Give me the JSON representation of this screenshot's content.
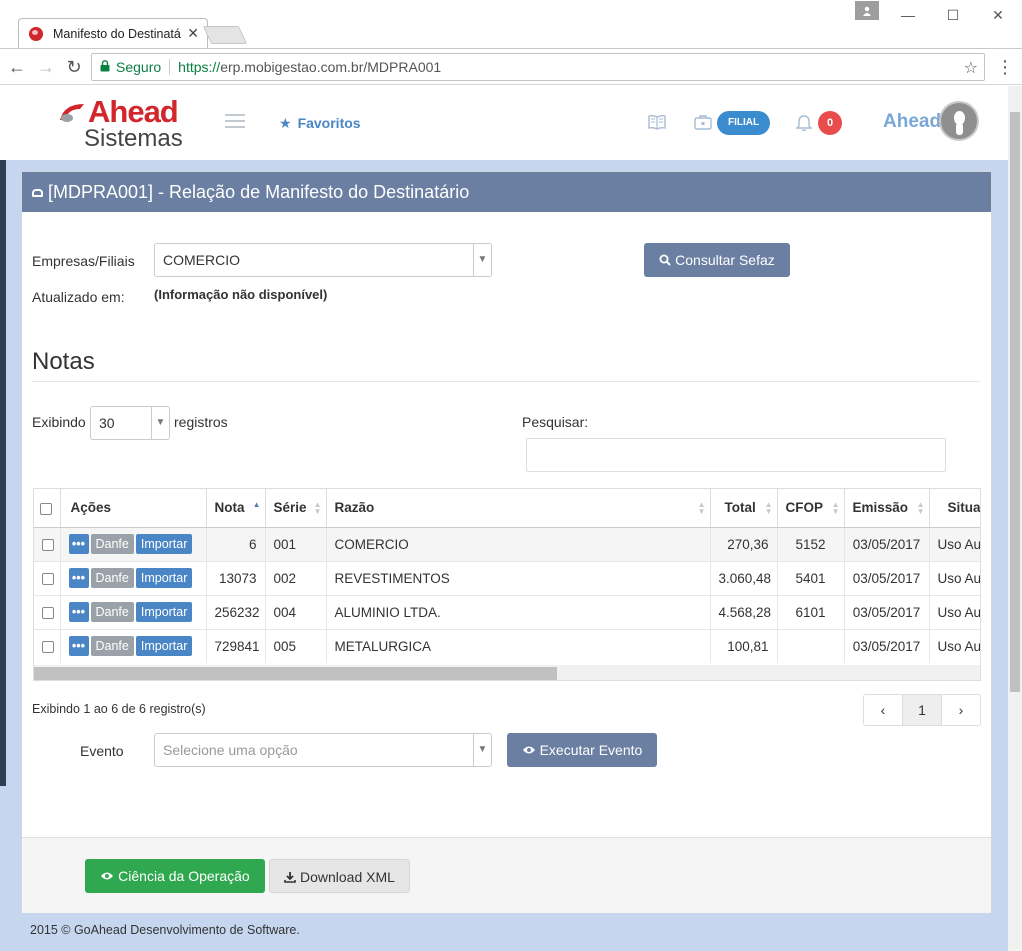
{
  "browser": {
    "tab_title": "Manifesto do Destinatário",
    "tab_close": "✕",
    "window_minimize": "—",
    "window_maximize": "☐",
    "window_close": "✕",
    "secure_label": "Seguro",
    "url_scheme": "https://",
    "url_rest": "erp.mobigestao.com.br/MDPRA001"
  },
  "header": {
    "logo_ahead": "Ahead",
    "logo_sistemas": "Sistemas",
    "favoritos": "Favoritos",
    "filial": "FILIAL",
    "notifications": "0",
    "user_name": "Ahead"
  },
  "card": {
    "title": "[MDPRA001] - Relação de Manifesto do Destinatário",
    "empresas_label": "Empresas/Filiais",
    "empresas_value": "COMERCIO",
    "consultar_button": "Consultar Sefaz",
    "atualizado_label": "Atualizado em:",
    "atualizado_value": "(Informação não disponível)"
  },
  "notas": {
    "title": "Notas",
    "exibindo_label": "Exibindo",
    "page_size": "30",
    "registros_label": "registros",
    "pesquisar_label": "Pesquisar:",
    "columns": [
      "Ações",
      "Nota",
      "Série",
      "Razão",
      "Total",
      "CFOP",
      "Emissão",
      "Situa"
    ],
    "action_labels": {
      "more": "•••",
      "danfe": "Danfe",
      "importar": "Importar"
    },
    "rows": [
      {
        "nota": "6",
        "serie": "001",
        "razao": "COMERCIO",
        "total": "270,36",
        "cfop": "5152",
        "emissao": "03/05/2017",
        "situacao": "Uso Au"
      },
      {
        "nota": "13073",
        "serie": "002",
        "razao": "REVESTIMENTOS",
        "total": "3.060,48",
        "cfop": "5401",
        "emissao": "03/05/2017",
        "situacao": "Uso Au"
      },
      {
        "nota": "256232",
        "serie": "004",
        "razao": "ALUMINIO LTDA.",
        "total": "4.568,28",
        "cfop": "6101",
        "emissao": "03/05/2017",
        "situacao": "Uso Au"
      },
      {
        "nota": "729841",
        "serie": "005",
        "razao": "METALURGICA",
        "total": "100,81",
        "cfop": "",
        "emissao": "03/05/2017",
        "situacao": "Uso Au"
      }
    ],
    "info": "Exibindo 1 ao 6 de 6 registro(s)",
    "pager": {
      "prev": "‹",
      "current": "1",
      "next": "›"
    }
  },
  "evento": {
    "label": "Evento",
    "placeholder": "Selecione uma opção",
    "executar_button": "Executar Evento"
  },
  "footer": {
    "ciencia_button": "Ciência da Operação",
    "download_button": "Download XML",
    "copyright": "2015 © GoAhead Desenvolvimento de Software."
  },
  "colors": {
    "header_slate": "#6b7fa2",
    "page_bg": "#c5d6ee",
    "brand_red": "#d2262d",
    "primary_blue": "#4a86c5",
    "success_green": "#2fa84f",
    "badge_red": "#e84c4c"
  }
}
